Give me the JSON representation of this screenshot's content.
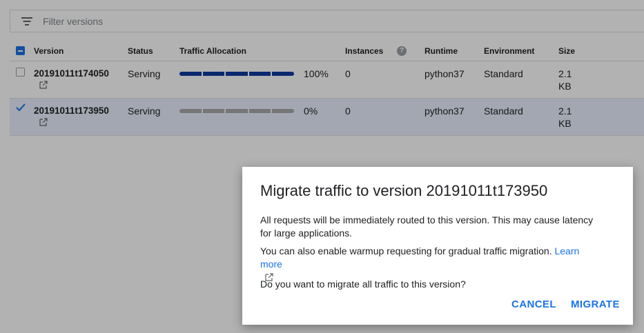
{
  "filter": {
    "placeholder": "Filter versions"
  },
  "table": {
    "headers": {
      "version": "Version",
      "status": "Status",
      "traffic": "Traffic Allocation",
      "instances": "Instances",
      "help": "?",
      "runtime": "Runtime",
      "environment": "Environment",
      "size": "Size"
    },
    "rows": [
      {
        "version": "20191011t174050",
        "status": "Serving",
        "traffic_percent_label": "100%",
        "traffic_fraction": 1.0,
        "instances": "0",
        "runtime": "python37",
        "environment": "Standard",
        "size_value": "2.1",
        "size_unit": "KB",
        "checked": false
      },
      {
        "version": "20191011t173950",
        "status": "Serving",
        "traffic_percent_label": "0%",
        "traffic_fraction": 0.0,
        "instances": "0",
        "runtime": "python37",
        "environment": "Standard",
        "size_value": "2.1",
        "size_unit": "KB",
        "checked": true
      }
    ]
  },
  "dialog": {
    "title": "Migrate traffic to version 20191011t173950",
    "p1": "All requests will be immediately routed to this version. This may cause latency for large applications.",
    "p2": "You can also enable warmup requesting for gradual traffic migration.",
    "learn_more": "Learn more",
    "p3": "Do you want to migrate all traffic to this version?",
    "cancel": "CANCEL",
    "migrate": "MIGRATE"
  },
  "colors": {
    "accent": "#1a73e8",
    "traffic_fill": "#0d3a9e",
    "traffic_empty": "#a9a9a9",
    "selected_row": "#e8f0fe"
  },
  "icons": {
    "filter": "filter-list-icon",
    "help": "help-circle-icon",
    "external": "open-in-new-icon",
    "checkbox": "checkbox-icon"
  }
}
